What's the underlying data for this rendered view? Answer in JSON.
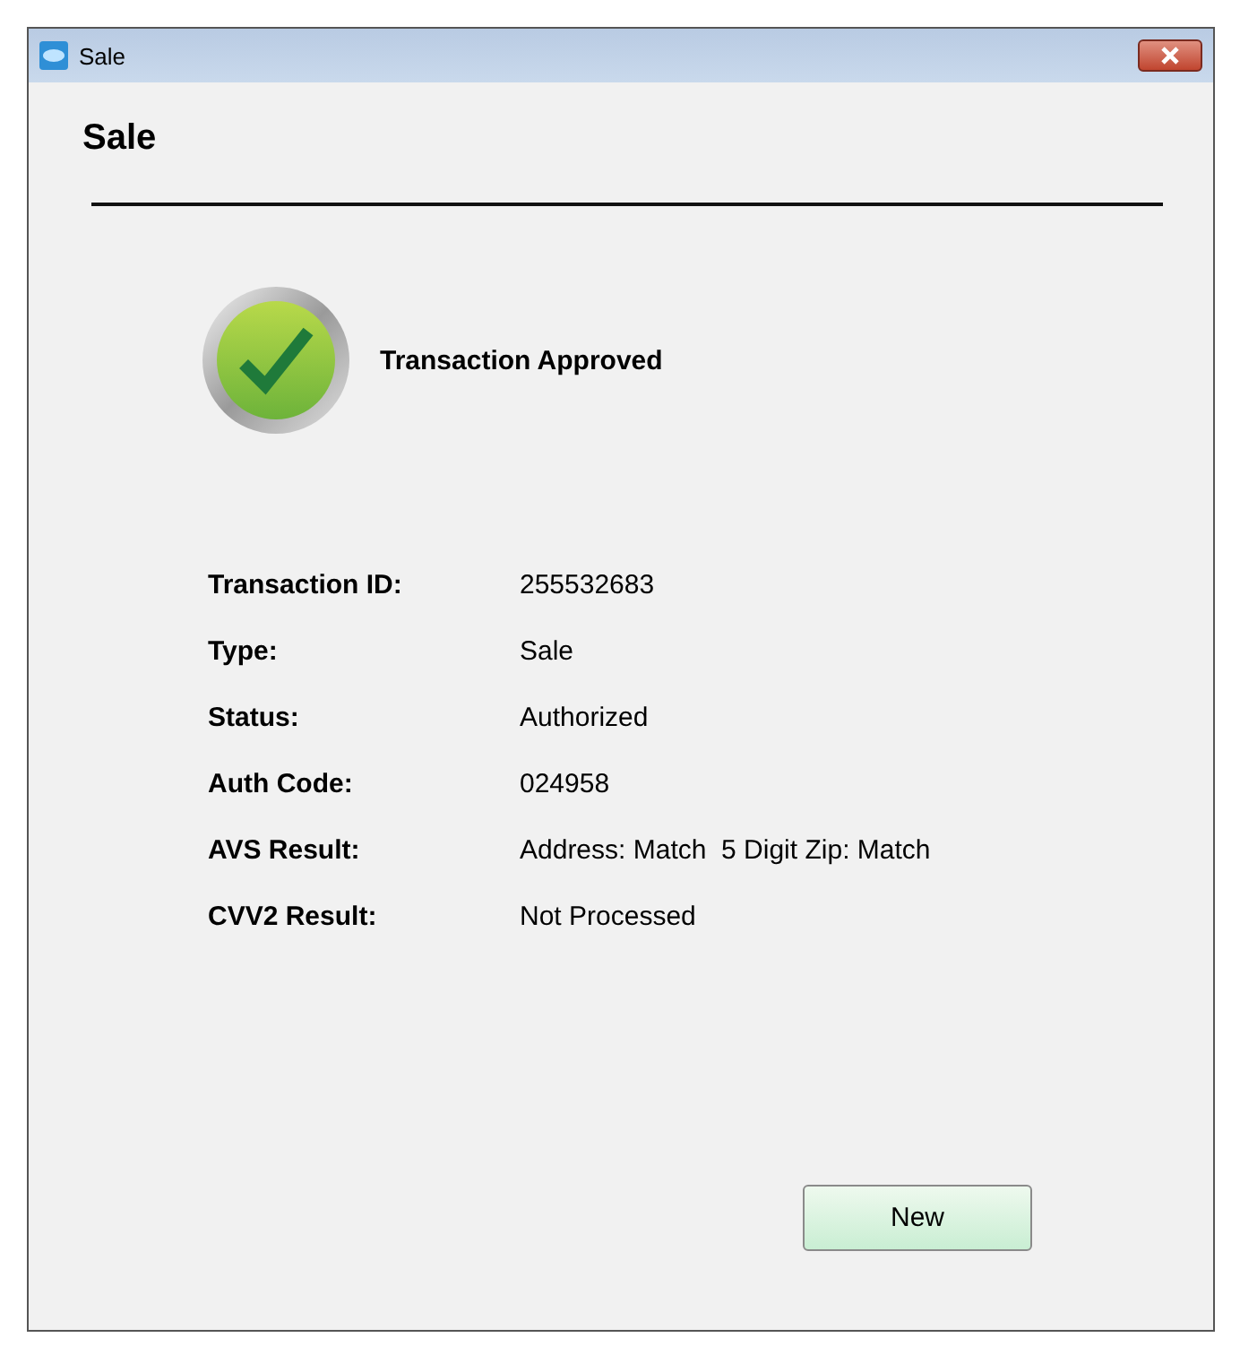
{
  "window": {
    "title": "Sale"
  },
  "heading": "Sale",
  "result": {
    "approved": true,
    "message": "Transaction Approved"
  },
  "details": [
    {
      "label": "Transaction ID:",
      "value": "255532683"
    },
    {
      "label": "Type:",
      "value": "Sale"
    },
    {
      "label": "Status:",
      "value": "Authorized"
    },
    {
      "label": "Auth Code:",
      "value": "024958"
    },
    {
      "label": "AVS Result:",
      "value": "Address: Match  5 Digit Zip: Match"
    },
    {
      "label": "CVV2 Result:",
      "value": "Not Processed"
    }
  ],
  "buttons": [
    "New"
  ]
}
